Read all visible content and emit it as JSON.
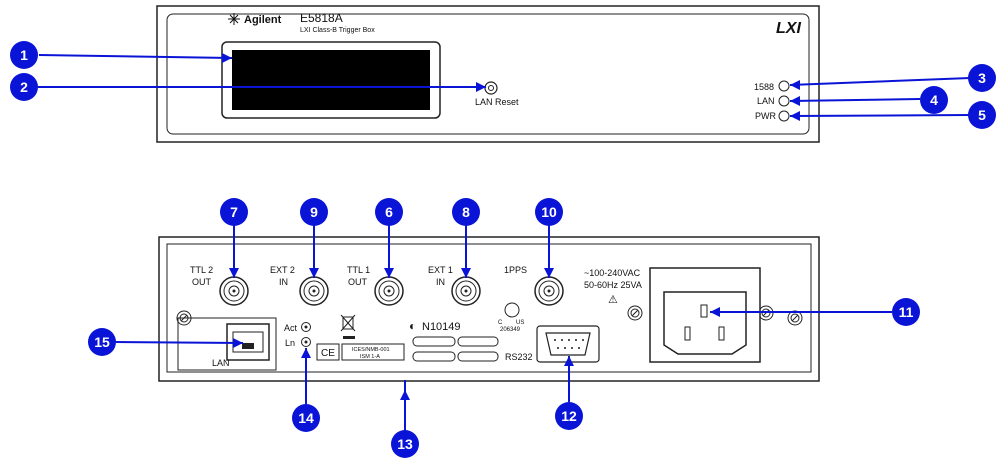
{
  "colors": {
    "callout": "#0a14d6",
    "outline": "#222222",
    "panel": "#ffffff"
  },
  "front": {
    "brand": "Agilent",
    "model": "E5818A",
    "subtitle": "LXI Class-B Trigger Box",
    "logo": "LXI",
    "lan_reset": "LAN Reset",
    "led_1588": "1588",
    "led_lan": "LAN",
    "led_pwr": "PWR"
  },
  "rear": {
    "ttl2_out": [
      "TTL 2",
      "OUT"
    ],
    "ext2_in": [
      "EXT 2",
      "IN"
    ],
    "ttl1_out": [
      "TTL 1",
      "OUT"
    ],
    "ext1_in": [
      "EXT 1",
      "IN"
    ],
    "pps": "1PPS",
    "power_rating": [
      "~100-240VAC",
      "50-60Hz 25VA"
    ],
    "lan": "LAN",
    "act": "Act",
    "ln": "Ln",
    "ctick": "N10149",
    "ce": "CE",
    "ices": [
      "ICES/NMB-001",
      "ISM 1-A"
    ],
    "csa": [
      "C",
      "US",
      "206349"
    ],
    "rs232": "RS232"
  },
  "callouts": [
    "1",
    "2",
    "3",
    "4",
    "5",
    "6",
    "7",
    "8",
    "9",
    "10",
    "11",
    "12",
    "13",
    "14",
    "15"
  ]
}
